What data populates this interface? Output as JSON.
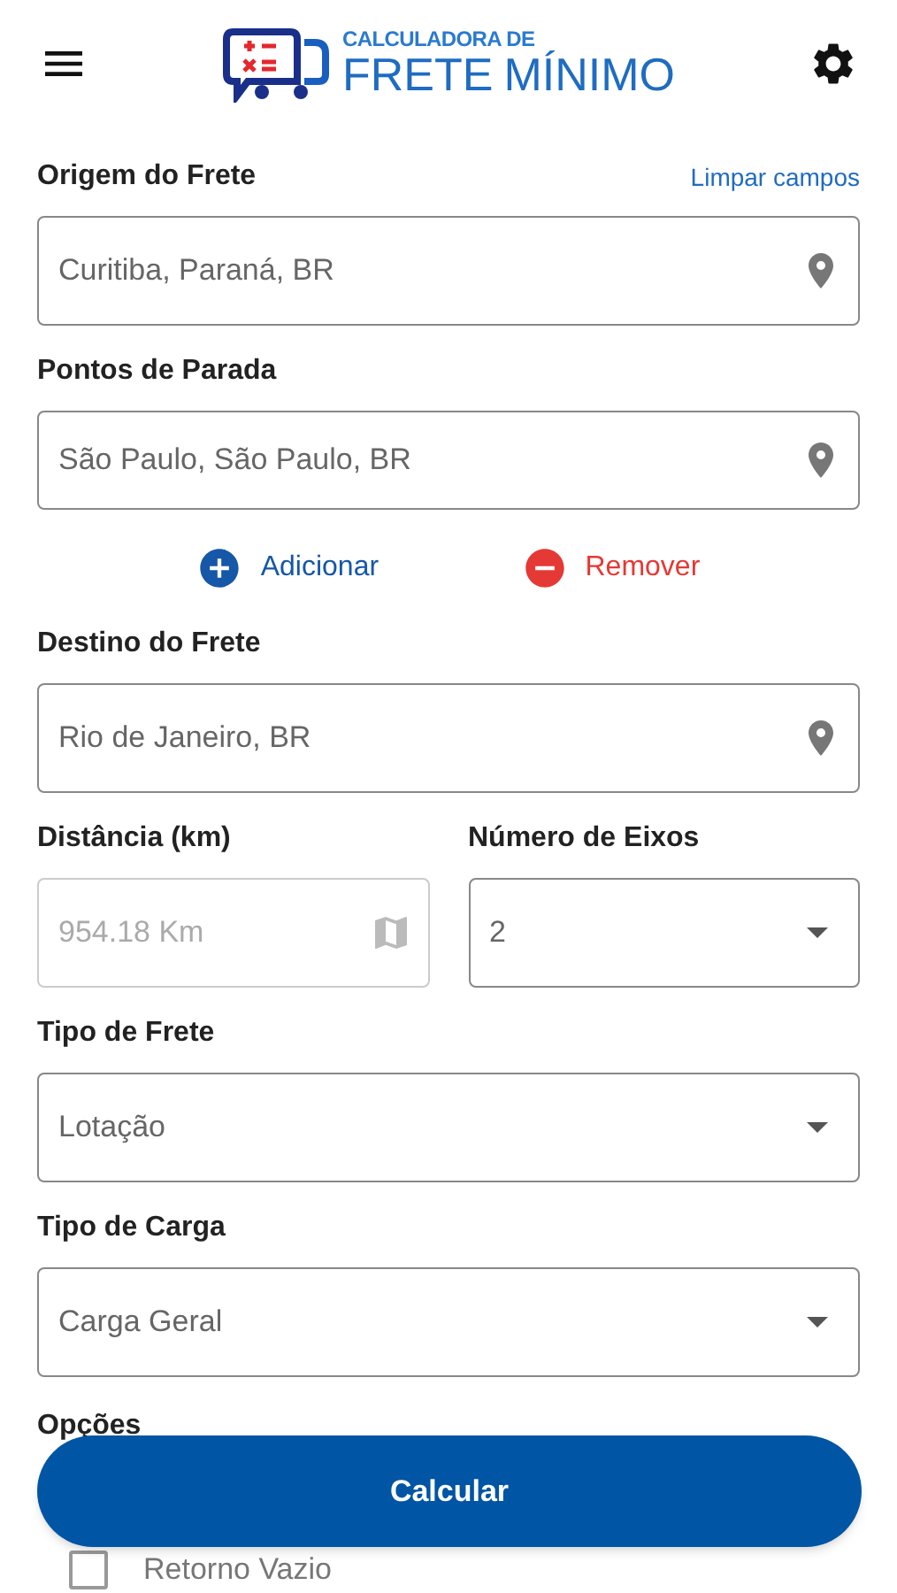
{
  "header": {
    "logo": {
      "line_1": "CALCULADORA DE",
      "line_2": "FRETE",
      "line_3": "MÍNIMO"
    }
  },
  "clear_link": "Limpar campos",
  "origin": {
    "label": "Origem do Frete",
    "value": "Curitiba, Paraná, BR"
  },
  "stops": {
    "label": "Pontos de Parada",
    "value": "São Paulo, São Paulo, BR"
  },
  "stop_actions": [
    {
      "kind": "add",
      "label": "Adicionar"
    },
    {
      "kind": "remove",
      "label": "Remover"
    }
  ],
  "destination": {
    "label": "Destino do Frete",
    "value": "Rio de Janeiro, BR"
  },
  "distance": {
    "label": "Distância (km)",
    "value": "954.18 Km",
    "disabled": true
  },
  "axles": {
    "label": "Número de Eixos",
    "value": "2"
  },
  "freight_type": {
    "label": "Tipo de Frete",
    "value": "Lotação"
  },
  "cargo_type": {
    "label": "Tipo de Carga",
    "value": "Carga Geral"
  },
  "options": {
    "label": "Opções",
    "items": [
      {
        "label": "Retorno Vazio",
        "checked": false
      }
    ]
  },
  "submit": "Calcular"
}
